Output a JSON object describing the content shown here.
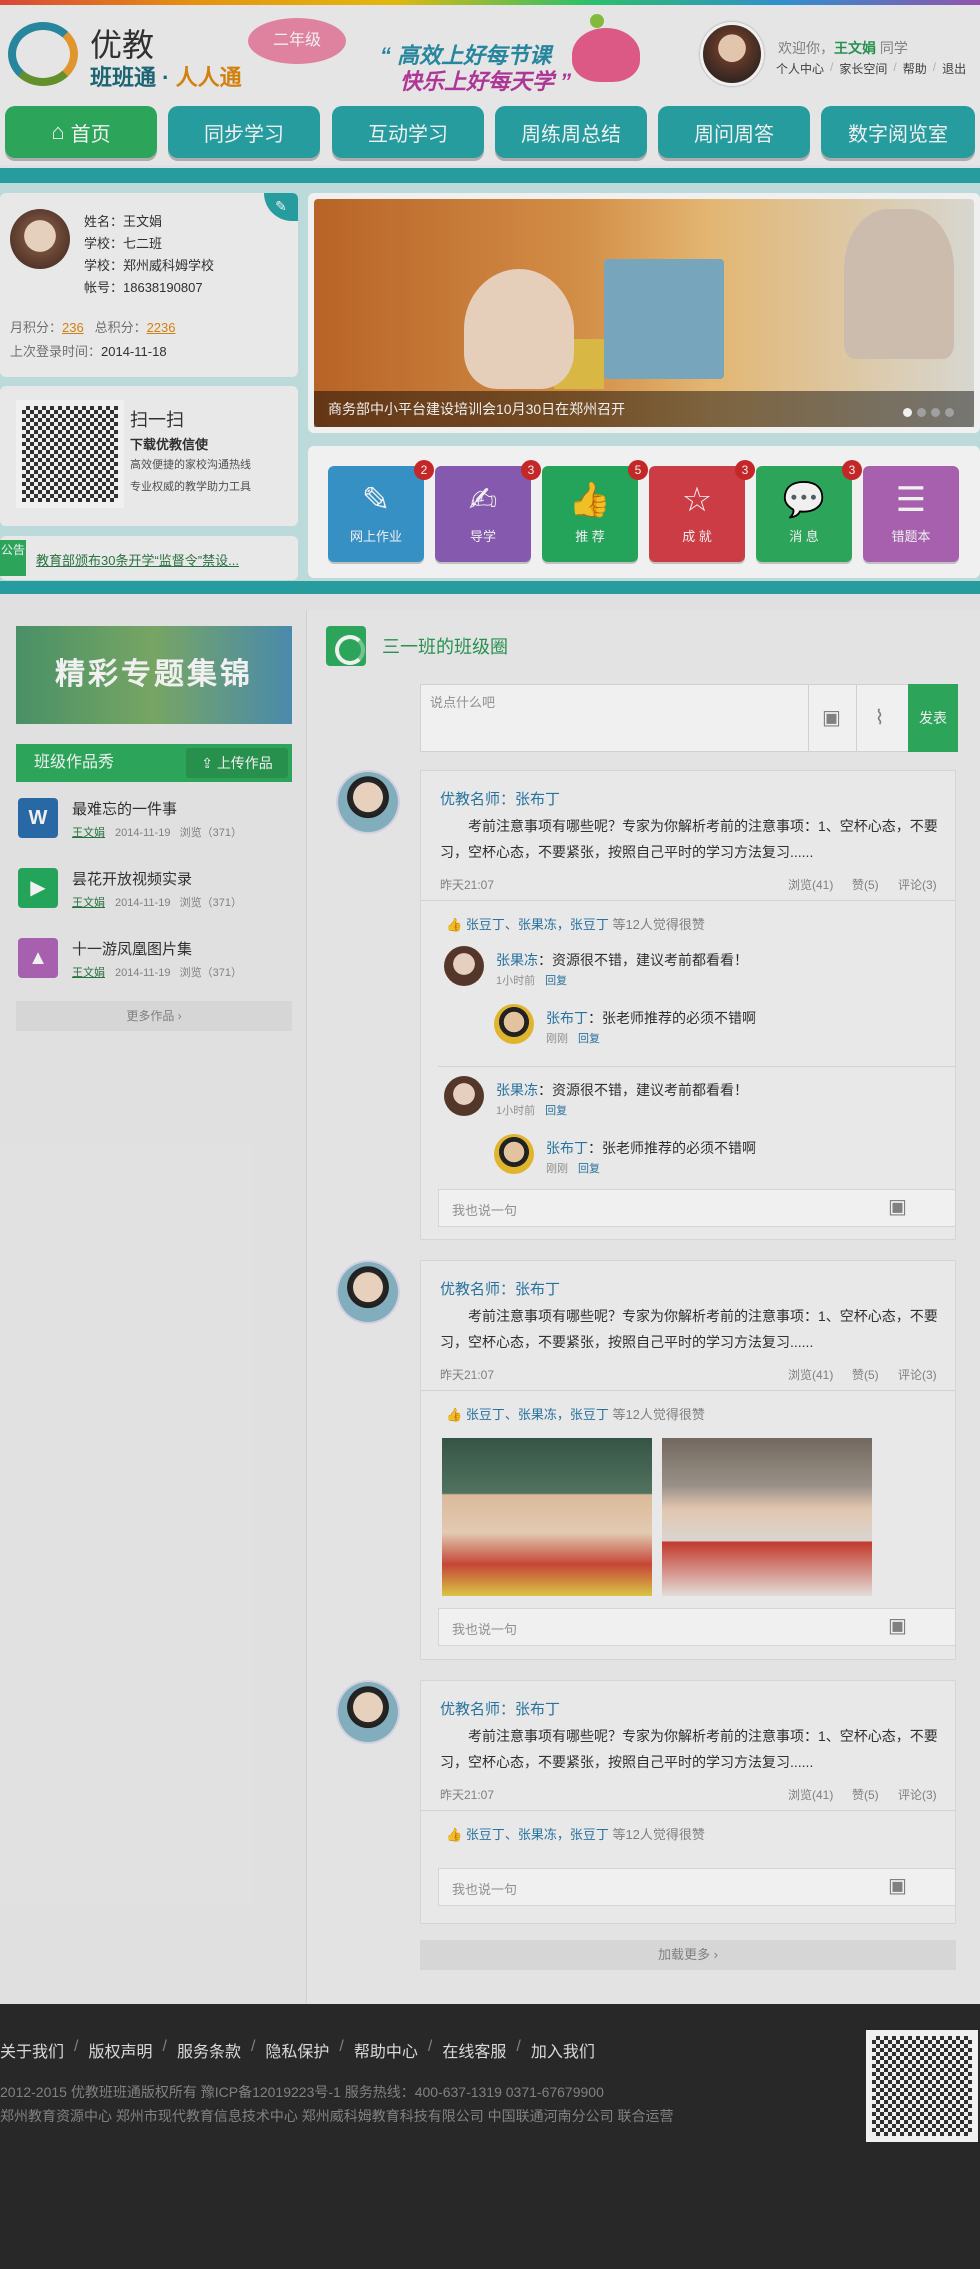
{
  "header": {
    "logo_title": "优教",
    "logo_sub_a": "班班通 · ",
    "logo_sub_b": "人人通",
    "grade_badge": "二年级",
    "slogan_line1": "“ 高效上好每节课",
    "slogan_line2": "快乐上好每天学 ”",
    "welcome_prefix": "欢迎你，",
    "user_name": "王文娟",
    "welcome_suffix": " 同学",
    "links": [
      "个人中心",
      "家长空间",
      "帮助",
      "退出"
    ]
  },
  "nav": [
    {
      "label": "首页",
      "icon": "home-icon"
    },
    {
      "label": "同步学习"
    },
    {
      "label": "互动学习"
    },
    {
      "label": "周练周总结"
    },
    {
      "label": "周问周答"
    },
    {
      "label": "数字阅览室"
    }
  ],
  "profile": {
    "name_label": "姓名：",
    "name": "王文娟",
    "school_label1": "学校：",
    "class": "七二班",
    "school_label2": "学校：",
    "school": "郑州威科姆学校",
    "account_label": "帐号：",
    "account": "18638190807",
    "month_points_label": "月积分：",
    "month_points": "236",
    "total_points_label": "总积分：",
    "total_points": "2236",
    "last_login_label": "上次登录时间：",
    "last_login": "2014-11-18"
  },
  "qr_promo": {
    "title": "扫一扫",
    "line1": "下载优教信使",
    "line2": "高效便捷的家校沟通热线",
    "line3": "专业权威的教学助力工具"
  },
  "notice": {
    "tag": "公告",
    "text": "教育部颁布30条开学“监督令”禁设..."
  },
  "banner": {
    "caption": "商务部中小平台建设培训会10月30日在郑州召开",
    "dots": 4
  },
  "tiles": [
    {
      "label": "网上作业",
      "badge": "2",
      "icon": "pencil-icon",
      "color": "#3a9ad0"
    },
    {
      "label": "导学",
      "badge": "3",
      "icon": "edit-icon",
      "color": "#8e5fb8"
    },
    {
      "label": "推 荐",
      "badge": "5",
      "icon": "thumbs-up-icon",
      "color": "#27ae60"
    },
    {
      "label": "成 就",
      "badge": "3",
      "icon": "star-icon",
      "color": "#d9404a"
    },
    {
      "label": "消 息",
      "badge": "3",
      "icon": "chat-icon",
      "color": "#2fb060"
    },
    {
      "label": "错题本",
      "badge": "",
      "icon": "list-icon",
      "color": "#b166b8"
    }
  ],
  "left": {
    "promo": "精彩专题集锦",
    "works_title": "班级作品秀",
    "upload": "上传作品",
    "works": [
      {
        "title": "最难忘的一件事",
        "author": "王文娟",
        "date": "2014-11-19",
        "views": "浏览（371）",
        "icon": "W",
        "color": "#2b6fb0"
      },
      {
        "title": "昙花开放视频实录",
        "author": "王文娟",
        "date": "2014-11-19",
        "views": "浏览（371）",
        "icon": "▶",
        "color": "#27ae60"
      },
      {
        "title": "十一游凤凰图片集",
        "author": "王文娟",
        "date": "2014-11-19",
        "views": "浏览（371）",
        "icon": "▲",
        "color": "#b166b8"
      }
    ],
    "more": "更多作品 ›"
  },
  "circle": {
    "title": "三一班的班级圈",
    "placeholder": "说点什么吧",
    "send": "发表",
    "load_more": "加载更多 ›"
  },
  "feeds": [
    {
      "author": "优教名师：张布丁",
      "text": "考前注意事项有哪些呢？专家为你解析考前的注意事项：1、空杯心态，不要习，空杯心态，不要紧张，按照自己平时的学习方法复习......",
      "time": "昨天21:07",
      "views": "浏览(41)",
      "likes": "赞(5)",
      "comments": "评论(3)",
      "like_names": "张豆丁、张果冻，张豆丁",
      "like_tail": " 等12人觉得很赞",
      "comments_list": [
        {
          "name": "张果冻",
          "body": "：资源很不错，建议考前都看看！",
          "time": "1小时前",
          "reply": "回复",
          "sub": {
            "name": "张布丁",
            "body": "：张老师推荐的必须不错啊",
            "time": "刚刚",
            "reply": "回复"
          }
        },
        {
          "name": "张果冻",
          "body": "：资源很不错，建议考前都看看！",
          "time": "1小时前",
          "reply": "回复",
          "sub": {
            "name": "张布丁",
            "body": "：张老师推荐的必须不错啊",
            "time": "刚刚",
            "reply": "回复"
          }
        }
      ],
      "say": "我也说一句"
    },
    {
      "author": "优教名师：张布丁",
      "text": "考前注意事项有哪些呢？专家为你解析考前的注意事项：1、空杯心态，不要习，空杯心态，不要紧张，按照自己平时的学习方法复习......",
      "time": "昨天21:07",
      "views": "浏览(41)",
      "likes": "赞(5)",
      "comments": "评论(3)",
      "like_names": "张豆丁、张果冻，张豆丁",
      "like_tail": " 等12人觉得很赞",
      "say": "我也说一句"
    },
    {
      "author": "优教名师：张布丁",
      "text": "考前注意事项有哪些呢？专家为你解析考前的注意事项：1、空杯心态，不要习，空杯心态，不要紧张，按照自己平时的学习方法复习......",
      "time": "昨天21:07",
      "views": "浏览(41)",
      "likes": "赞(5)",
      "comments": "评论(3)",
      "like_names": "张豆丁、张果冻，张豆丁",
      "like_tail": " 等12人觉得很赞",
      "say": "我也说一句"
    }
  ],
  "footer": {
    "links": [
      "关于我们",
      "版权声明",
      "服务条款",
      "隐私保护",
      "帮助中心",
      "在线客服",
      "加入我们"
    ],
    "copyright": "2012-2015 优教班班通版权所有  豫ICP备12019223号-1      服务热线：400-637-1319    0371-67679900",
    "orgs": "郑州教育资源中心     郑州市现代教育信息技术中心     郑州威科姆教育科技有限公司 中国联通河南分公司  联合运营"
  }
}
